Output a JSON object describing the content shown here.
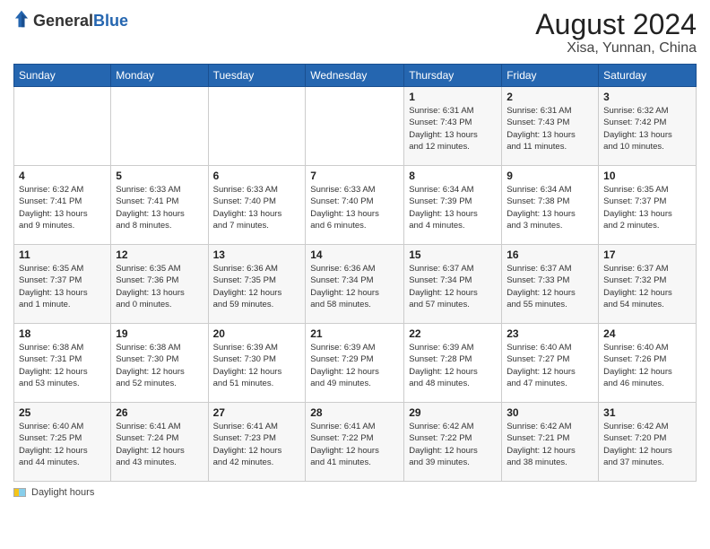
{
  "header": {
    "logo_general": "General",
    "logo_blue": "Blue",
    "month_year": "August 2024",
    "location": "Xisa, Yunnan, China"
  },
  "calendar": {
    "days_of_week": [
      "Sunday",
      "Monday",
      "Tuesday",
      "Wednesday",
      "Thursday",
      "Friday",
      "Saturday"
    ],
    "weeks": [
      [
        {
          "day": "",
          "info": ""
        },
        {
          "day": "",
          "info": ""
        },
        {
          "day": "",
          "info": ""
        },
        {
          "day": "",
          "info": ""
        },
        {
          "day": "1",
          "info": "Sunrise: 6:31 AM\nSunset: 7:43 PM\nDaylight: 13 hours\nand 12 minutes."
        },
        {
          "day": "2",
          "info": "Sunrise: 6:31 AM\nSunset: 7:43 PM\nDaylight: 13 hours\nand 11 minutes."
        },
        {
          "day": "3",
          "info": "Sunrise: 6:32 AM\nSunset: 7:42 PM\nDaylight: 13 hours\nand 10 minutes."
        }
      ],
      [
        {
          "day": "4",
          "info": "Sunrise: 6:32 AM\nSunset: 7:41 PM\nDaylight: 13 hours\nand 9 minutes."
        },
        {
          "day": "5",
          "info": "Sunrise: 6:33 AM\nSunset: 7:41 PM\nDaylight: 13 hours\nand 8 minutes."
        },
        {
          "day": "6",
          "info": "Sunrise: 6:33 AM\nSunset: 7:40 PM\nDaylight: 13 hours\nand 7 minutes."
        },
        {
          "day": "7",
          "info": "Sunrise: 6:33 AM\nSunset: 7:40 PM\nDaylight: 13 hours\nand 6 minutes."
        },
        {
          "day": "8",
          "info": "Sunrise: 6:34 AM\nSunset: 7:39 PM\nDaylight: 13 hours\nand 4 minutes."
        },
        {
          "day": "9",
          "info": "Sunrise: 6:34 AM\nSunset: 7:38 PM\nDaylight: 13 hours\nand 3 minutes."
        },
        {
          "day": "10",
          "info": "Sunrise: 6:35 AM\nSunset: 7:37 PM\nDaylight: 13 hours\nand 2 minutes."
        }
      ],
      [
        {
          "day": "11",
          "info": "Sunrise: 6:35 AM\nSunset: 7:37 PM\nDaylight: 13 hours\nand 1 minute."
        },
        {
          "day": "12",
          "info": "Sunrise: 6:35 AM\nSunset: 7:36 PM\nDaylight: 13 hours\nand 0 minutes."
        },
        {
          "day": "13",
          "info": "Sunrise: 6:36 AM\nSunset: 7:35 PM\nDaylight: 12 hours\nand 59 minutes."
        },
        {
          "day": "14",
          "info": "Sunrise: 6:36 AM\nSunset: 7:34 PM\nDaylight: 12 hours\nand 58 minutes."
        },
        {
          "day": "15",
          "info": "Sunrise: 6:37 AM\nSunset: 7:34 PM\nDaylight: 12 hours\nand 57 minutes."
        },
        {
          "day": "16",
          "info": "Sunrise: 6:37 AM\nSunset: 7:33 PM\nDaylight: 12 hours\nand 55 minutes."
        },
        {
          "day": "17",
          "info": "Sunrise: 6:37 AM\nSunset: 7:32 PM\nDaylight: 12 hours\nand 54 minutes."
        }
      ],
      [
        {
          "day": "18",
          "info": "Sunrise: 6:38 AM\nSunset: 7:31 PM\nDaylight: 12 hours\nand 53 minutes."
        },
        {
          "day": "19",
          "info": "Sunrise: 6:38 AM\nSunset: 7:30 PM\nDaylight: 12 hours\nand 52 minutes."
        },
        {
          "day": "20",
          "info": "Sunrise: 6:39 AM\nSunset: 7:30 PM\nDaylight: 12 hours\nand 51 minutes."
        },
        {
          "day": "21",
          "info": "Sunrise: 6:39 AM\nSunset: 7:29 PM\nDaylight: 12 hours\nand 49 minutes."
        },
        {
          "day": "22",
          "info": "Sunrise: 6:39 AM\nSunset: 7:28 PM\nDaylight: 12 hours\nand 48 minutes."
        },
        {
          "day": "23",
          "info": "Sunrise: 6:40 AM\nSunset: 7:27 PM\nDaylight: 12 hours\nand 47 minutes."
        },
        {
          "day": "24",
          "info": "Sunrise: 6:40 AM\nSunset: 7:26 PM\nDaylight: 12 hours\nand 46 minutes."
        }
      ],
      [
        {
          "day": "25",
          "info": "Sunrise: 6:40 AM\nSunset: 7:25 PM\nDaylight: 12 hours\nand 44 minutes."
        },
        {
          "day": "26",
          "info": "Sunrise: 6:41 AM\nSunset: 7:24 PM\nDaylight: 12 hours\nand 43 minutes."
        },
        {
          "day": "27",
          "info": "Sunrise: 6:41 AM\nSunset: 7:23 PM\nDaylight: 12 hours\nand 42 minutes."
        },
        {
          "day": "28",
          "info": "Sunrise: 6:41 AM\nSunset: 7:22 PM\nDaylight: 12 hours\nand 41 minutes."
        },
        {
          "day": "29",
          "info": "Sunrise: 6:42 AM\nSunset: 7:22 PM\nDaylight: 12 hours\nand 39 minutes."
        },
        {
          "day": "30",
          "info": "Sunrise: 6:42 AM\nSunset: 7:21 PM\nDaylight: 12 hours\nand 38 minutes."
        },
        {
          "day": "31",
          "info": "Sunrise: 6:42 AM\nSunset: 7:20 PM\nDaylight: 12 hours\nand 37 minutes."
        }
      ]
    ]
  },
  "footer": {
    "label": "Daylight hours"
  }
}
